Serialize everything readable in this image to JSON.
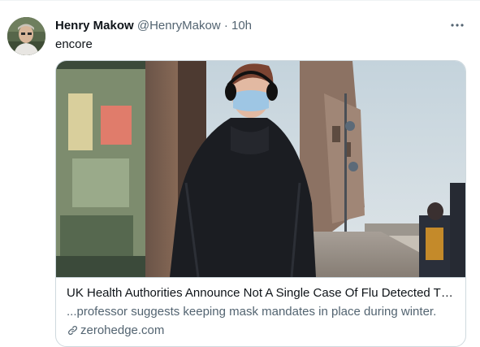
{
  "tweet": {
    "author_name": "Henry Makow",
    "handle": "@HenryMakow",
    "separator": "·",
    "time": "10h",
    "text": "encore",
    "more_icon": "more-horizontal-icon"
  },
  "card": {
    "title": "UK Health Authorities Announce Not A Single Case Of Flu Detected Thi...",
    "description": "...professor suggests keeping mask mandates in place during winter.",
    "domain": "zerohedge.com",
    "link_icon": "link-icon"
  }
}
